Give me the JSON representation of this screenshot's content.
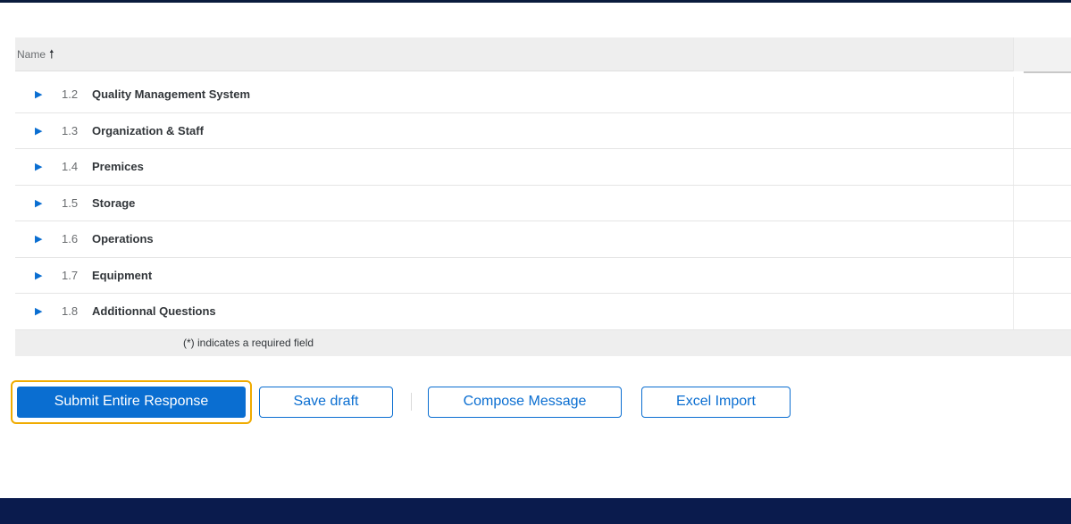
{
  "table": {
    "header": {
      "name_label": "Name",
      "sort_icon": "arrow-up-icon"
    },
    "rows": [
      {
        "number": "1.2",
        "title": "Quality Management System"
      },
      {
        "number": "1.3",
        "title": "Organization & Staff"
      },
      {
        "number": "1.4",
        "title": "Premices"
      },
      {
        "number": "1.5",
        "title": "Storage"
      },
      {
        "number": "1.6",
        "title": "Operations"
      },
      {
        "number": "1.7",
        "title": "Equipment"
      },
      {
        "number": "1.8",
        "title": "Additionnal Questions"
      }
    ],
    "required_note": "(*) indicates a required field"
  },
  "actions": {
    "submit_label": "Submit Entire Response",
    "save_draft_label": "Save draft",
    "compose_label": "Compose Message",
    "excel_import_label": "Excel Import"
  },
  "colors": {
    "accent": "#0a6ed1",
    "highlight": "#f0ab00",
    "footer": "#0a1b4d"
  }
}
